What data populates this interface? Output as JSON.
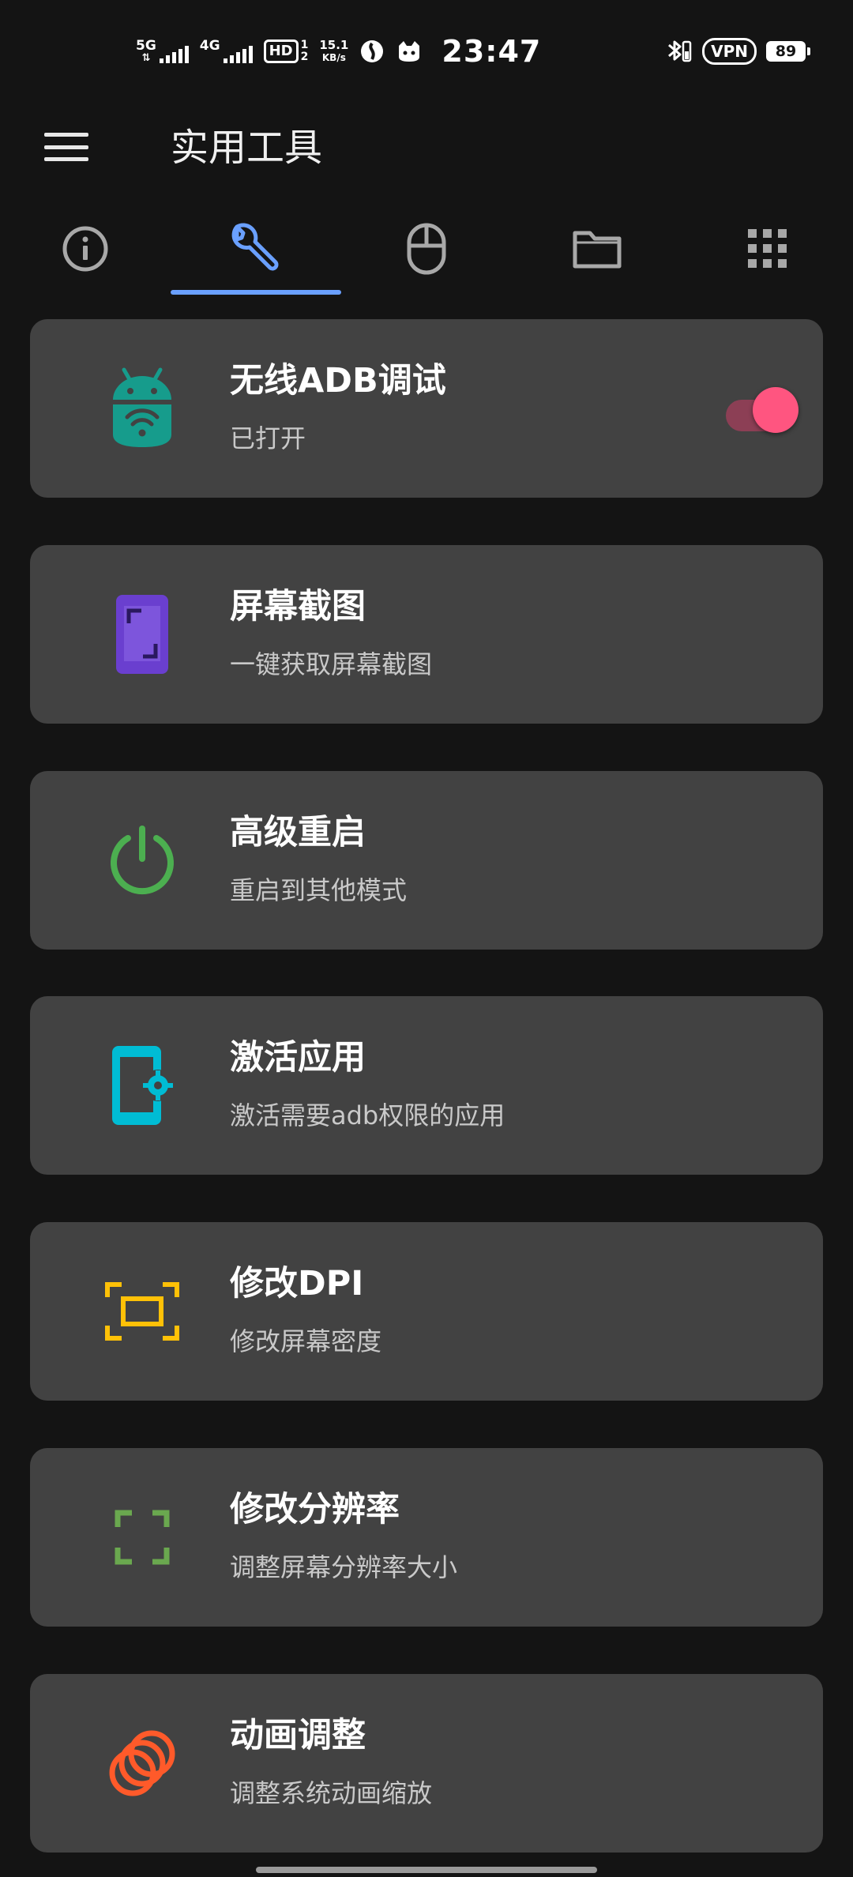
{
  "status_bar": {
    "sig1": "5G",
    "sig2": "4G",
    "hd": "HD",
    "hd_top": "1",
    "hd_bottom": "2",
    "speed_value": "15.1",
    "speed_unit": "KB/s",
    "time": "23:47",
    "vpn": "VPN",
    "battery": "89"
  },
  "app_bar": {
    "title": "实用工具"
  },
  "tabs": [
    {
      "icon": "info-icon"
    },
    {
      "icon": "wrench-icon",
      "selected": true
    },
    {
      "icon": "mouse-icon"
    },
    {
      "icon": "folder-icon"
    },
    {
      "icon": "apps-grid-icon"
    }
  ],
  "colors": {
    "background": "#141414",
    "card": "#424242",
    "accent_blue": "#6aa0ff",
    "switch_pink": "#ff5580",
    "android_teal": "#169c8c",
    "screenshot_purple": "#6a3fcf",
    "power_green": "#4caf50",
    "activate_cyan": "#00bcd4",
    "dpi_yellow": "#ffc107",
    "resolution_green": "#6aa84f",
    "animation_orange": "#ff5a2a"
  },
  "cards": [
    {
      "title": "无线ADB调试",
      "subtitle": "已打开",
      "icon": "android-wifi-icon",
      "switch_on": true
    },
    {
      "title": "屏幕截图",
      "subtitle": "一键获取屏幕截图",
      "icon": "screenshot-icon"
    },
    {
      "title": "高级重启",
      "subtitle": "重启到其他模式",
      "icon": "power-icon"
    },
    {
      "title": "激活应用",
      "subtitle": "激活需要adb权限的应用",
      "icon": "phone-settings-icon"
    },
    {
      "title": "修改DPI",
      "subtitle": "修改屏幕密度",
      "icon": "screen-density-icon"
    },
    {
      "title": "修改分辨率",
      "subtitle": "调整屏幕分辨率大小",
      "icon": "resolution-frame-icon"
    },
    {
      "title": "动画调整",
      "subtitle": "调整系统动画缩放",
      "icon": "animation-rings-icon"
    }
  ]
}
